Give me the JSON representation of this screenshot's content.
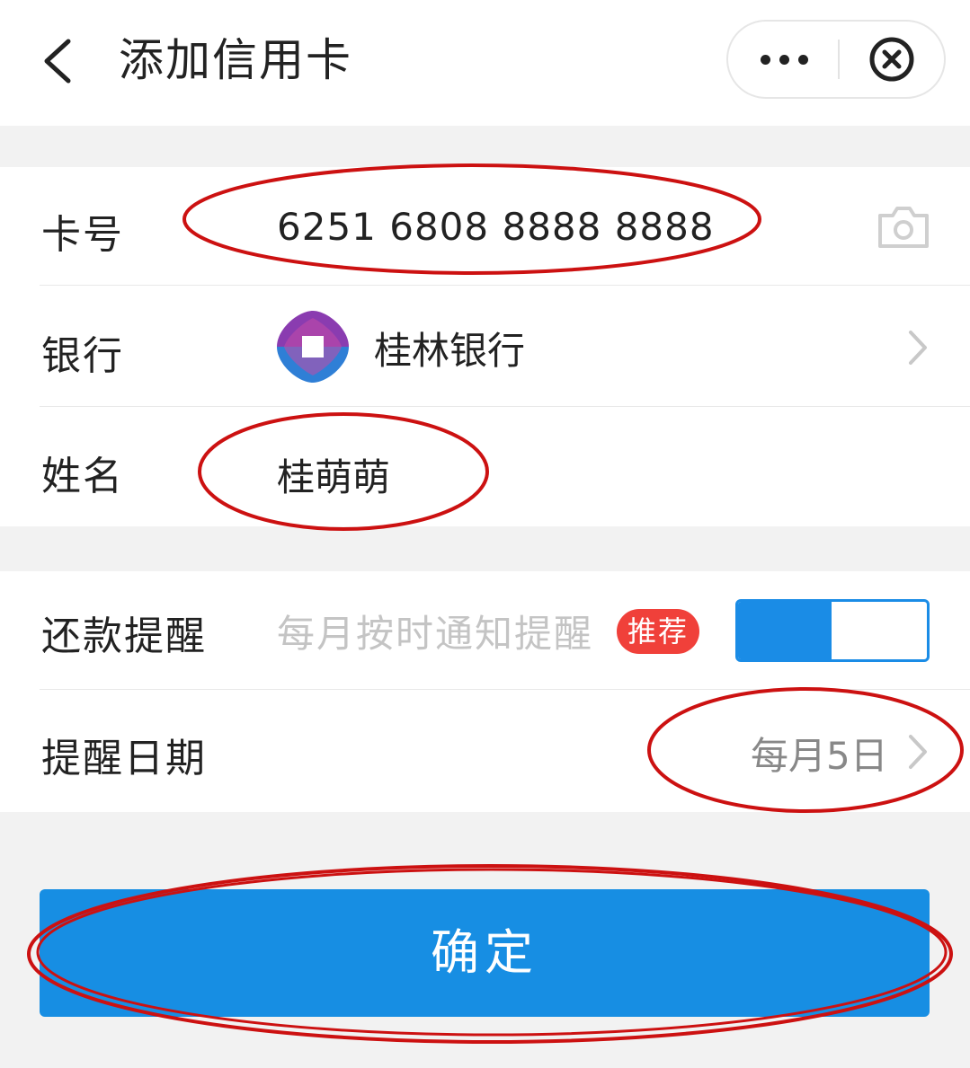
{
  "header": {
    "title": "添加信用卡",
    "back_icon": "chevron-left-icon",
    "more_icon": "more-dots-icon",
    "close_icon": "close-circle-icon"
  },
  "card_form": {
    "card_number_label": "卡号",
    "card_number_value": "6251 6808 8888 8888",
    "camera_icon": "camera-icon",
    "bank_label": "银行",
    "bank_name": "桂林银行",
    "bank_logo": "bank-logo-icon",
    "name_label": "姓名",
    "name_value": "桂萌萌"
  },
  "reminder": {
    "repay_label": "还款提醒",
    "repay_hint": "每月按时通知提醒",
    "recommend_badge": "推荐",
    "toggle_on": true,
    "date_label": "提醒日期",
    "date_value": "每月5日"
  },
  "confirm_label": "确定",
  "colors": {
    "accent": "#178ee3",
    "badge": "#f0403a",
    "annotation": "#cc1111",
    "background": "#f2f2f2"
  }
}
